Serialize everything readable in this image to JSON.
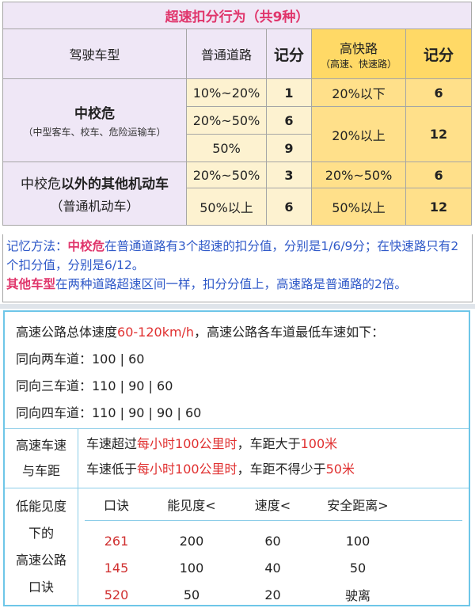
{
  "table1": {
    "title": "超速扣分行为（共9种）",
    "headers": {
      "vehicle": "驾驶车型",
      "normal_road": "普通道路",
      "points": "记分",
      "highway": "高快路",
      "highway_sub": "（高速、快速路）",
      "points2": "记分"
    },
    "group1": {
      "name": "中校危",
      "sub": "（中型客车、校车、危险运输车）",
      "rows": [
        {
          "normal": "10%~20%",
          "points": "1",
          "highway": "20%以下",
          "hpoints": "6"
        },
        {
          "normal": "20%~50%",
          "points": "6",
          "highway": "20%以上",
          "hpoints": "12"
        },
        {
          "normal": "50%",
          "points": "9"
        }
      ]
    },
    "group2": {
      "name_a": "中校危",
      "name_b": "以外的其他机动车",
      "sub": "（普通机动车）",
      "rows": [
        {
          "normal": "20%~50%",
          "points": "3",
          "highway": "20%~50%",
          "hpoints": "6"
        },
        {
          "normal": "50%以上",
          "points": "6",
          "highway": "50%以上",
          "hpoints": "12"
        }
      ]
    }
  },
  "memo": {
    "p1_a": "记忆方法：",
    "p1_b": "中校危",
    "p1_c": "在普通道路有3个超速的扣分值，分别是1/6/9分；在快速路只有2个扣分值，分别是6/12。",
    "p2_a": "其他车型",
    "p2_b": "在两种道路超速区间一样，扣分分值上，高速路是普通路的2倍。"
  },
  "highway": {
    "intro_a": "高速公路总体速度",
    "intro_speed": "60-120km/h",
    "intro_b": "，高速公路各车道最低车速如下：",
    "lanes": [
      "同向两车道：100 | 60",
      "同向三车道：110 | 90 | 60",
      "同向四车道：110 | 90 | 90 | 60"
    ],
    "distance_label_1": "高速车速",
    "distance_label_2": "与车距",
    "dist1_a": "车速超过",
    "dist1_b": "每小时100公里时",
    "dist1_c": "，车距大于",
    "dist1_d": "100米",
    "dist2_a": "车速低于",
    "dist2_b": "每小时100公里时",
    "dist2_c": "，车距不得少于",
    "dist2_d": "50米",
    "lowvis_label": [
      "低能见度",
      "下的",
      "高速公路",
      "口诀"
    ],
    "lowvis_headers": [
      "口诀",
      "能见度<",
      "速度<",
      "安全距离>"
    ],
    "lowvis_rows": [
      {
        "code": "261",
        "vis": "200",
        "speed": "60",
        "dist": "100"
      },
      {
        "code": "145",
        "vis": "100",
        "speed": "40",
        "dist": "50"
      },
      {
        "code": "520",
        "vis": "50",
        "speed": "20",
        "dist": "驶离"
      }
    ]
  }
}
